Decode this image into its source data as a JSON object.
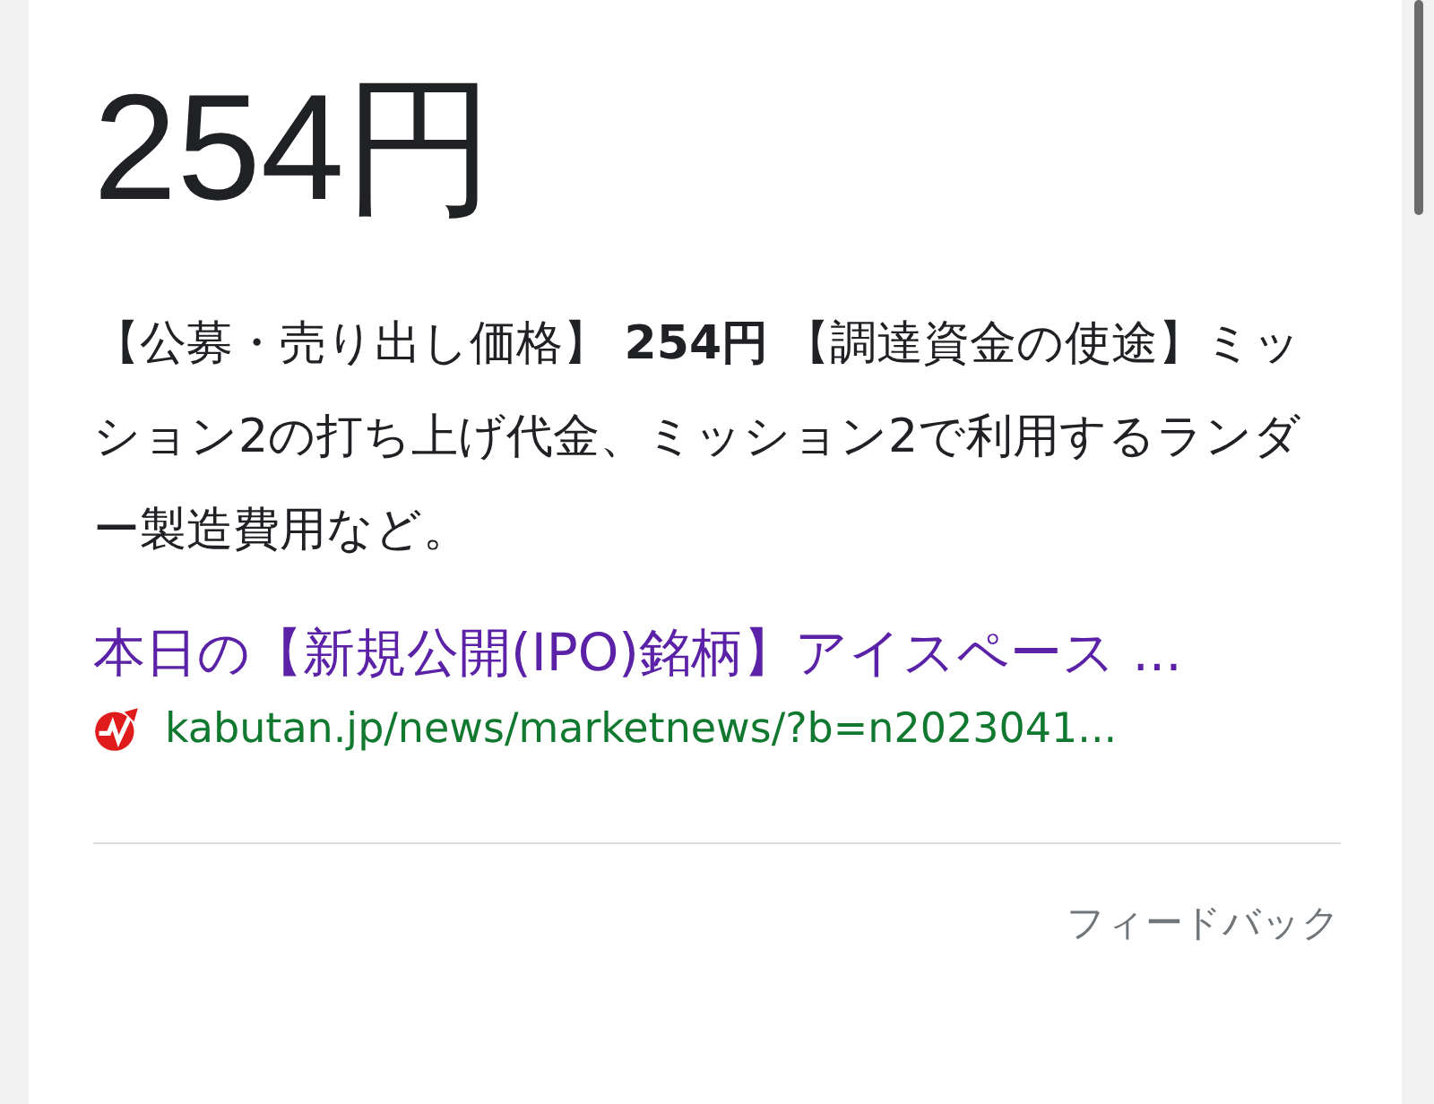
{
  "answer": {
    "price": "254円",
    "snippet": "【公募・売り出し価格】 **254円** 【調達資金の使途】ミッション2の打ち上げ代金、ミッション2で利用するランダー製造費用など。"
  },
  "result": {
    "title": "本日の【新規公開(IPO)銘柄】アイスペース ...",
    "url": "kabutan.jp/news/marketnews/?b=n2023041..."
  },
  "feedback": "フィードバック"
}
